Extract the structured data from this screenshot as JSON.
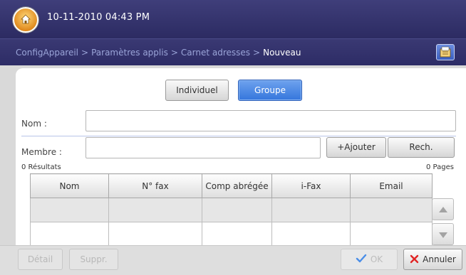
{
  "header": {
    "datetime": "10-11-2010 04:43 PM"
  },
  "breadcrumb": {
    "items": [
      "ConfigAppareil",
      "Paramètres applis",
      "Carnet adresses"
    ],
    "current": "Nouveau",
    "separator": ">"
  },
  "mode_toggle": {
    "individuel": "Individuel",
    "groupe": "Groupe",
    "selected": "Groupe"
  },
  "form": {
    "nom_label": "Nom :",
    "nom_value": "",
    "membre_label": "Membre :",
    "membre_value": "",
    "ajouter_label": "+Ajouter",
    "rech_label": "Rech."
  },
  "results": {
    "count_label": "0 Résultats",
    "pages_label": "0 Pages"
  },
  "table": {
    "headers": [
      "Nom",
      "N° fax",
      "Comp abrégée",
      "i-Fax",
      "Email"
    ],
    "rows": [
      [
        "",
        "",
        "",
        "",
        ""
      ],
      [
        "",
        "",
        "",
        "",
        ""
      ]
    ]
  },
  "footer": {
    "detail": "Détail",
    "suppr": "Suppr.",
    "ok": "OK",
    "annuler": "Annuler"
  },
  "colors": {
    "header_bg": "#2c2b62",
    "selected_toggle": "#3576dc",
    "ok_check": "#4a8ee8",
    "cancel_x": "#e02424"
  }
}
